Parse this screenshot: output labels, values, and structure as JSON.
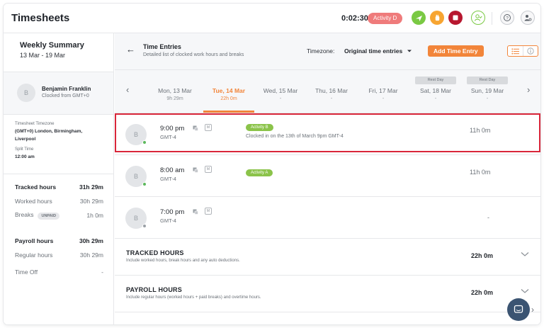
{
  "app": {
    "title": "Timesheets"
  },
  "topbar": {
    "timer": "0:02:30",
    "current_activity": "Activity D",
    "icons": [
      "plane-icon",
      "hand-icon",
      "stop-icon",
      "user-check-icon",
      "help-icon",
      "person-settings-icon"
    ],
    "colors": {
      "green": "#7ac943",
      "orange": "#f7a531",
      "red": "#b7172f",
      "activity_pill": "#ef7b7b"
    }
  },
  "summary_panel": {
    "title": "Weekly Summary",
    "range": "13 Mar - 19 Mar",
    "user": {
      "initial": "B",
      "name": "Benjamin Franklin",
      "subtitle": "Clocked from GMT+0"
    },
    "timezone_label": "Timesheet Timezone",
    "timezone_value": "(GMT+0) London, Birmingham, Liverpool",
    "split_label": "Split Time",
    "split_value": "12:00 am",
    "stats": {
      "tracked_label": "Tracked hours",
      "tracked_value": "31h 29m",
      "worked_label": "Worked hours",
      "worked_value": "30h 29m",
      "breaks_label": "Breaks",
      "breaks_badge": "UNPAID",
      "breaks_value": "1h 0m",
      "payroll_label": "Payroll hours",
      "payroll_value": "30h 29m",
      "regular_label": "Regular hours",
      "regular_value": "30h 29m",
      "timeoff_label": "Time Off",
      "timeoff_value": "-"
    }
  },
  "main": {
    "title": "Time Entries",
    "subtitle": "Detailed list of clocked work hours and breaks",
    "timezone_label": "Timezone:",
    "timezone_select": "Original time entries",
    "add_button": "Add Time Entry",
    "accent": "#f2853a",
    "days": [
      {
        "name": "Mon, 13 Mar",
        "value": "9h 29m",
        "rest": ""
      },
      {
        "name": "Tue, 14 Mar",
        "value": "22h 0m",
        "rest": "",
        "active": true
      },
      {
        "name": "Wed, 15 Mar",
        "value": "-",
        "rest": ""
      },
      {
        "name": "Thu, 16 Mar",
        "value": "-",
        "rest": ""
      },
      {
        "name": "Fri, 17 Mar",
        "value": "-",
        "rest": ""
      },
      {
        "name": "Sat, 18 Mar",
        "value": "-",
        "rest": "Rest Day"
      },
      {
        "name": "Sun, 19 Mar",
        "value": "-",
        "rest": "Rest Day"
      }
    ],
    "entries": [
      {
        "initial": "B",
        "time": "9:00 pm",
        "tz": "GMT-4",
        "badge": "M",
        "activity": "Activity B",
        "note": "Clocked in on the 13th of March 9pm GMT-4",
        "duration": "11h 0m"
      },
      {
        "initial": "B",
        "time": "8:00 am",
        "tz": "GMT-4",
        "badge": "M",
        "activity": "Activity A",
        "note": "",
        "duration": "11h 0m"
      },
      {
        "initial": "B",
        "time": "7:00 pm",
        "tz": "GMT-4",
        "badge": "M",
        "activity": "",
        "note": "",
        "duration": "-"
      }
    ],
    "tracked": {
      "title": "TRACKED HOURS",
      "subtitle": "Include worked hours, break hours and any auto deductions.",
      "value": "22h 0m"
    },
    "payroll": {
      "title": "PAYROLL HOURS",
      "subtitle": "Include regular hours (worked hours + paid breaks) and overtime hours.",
      "value": "22h 0m"
    }
  }
}
